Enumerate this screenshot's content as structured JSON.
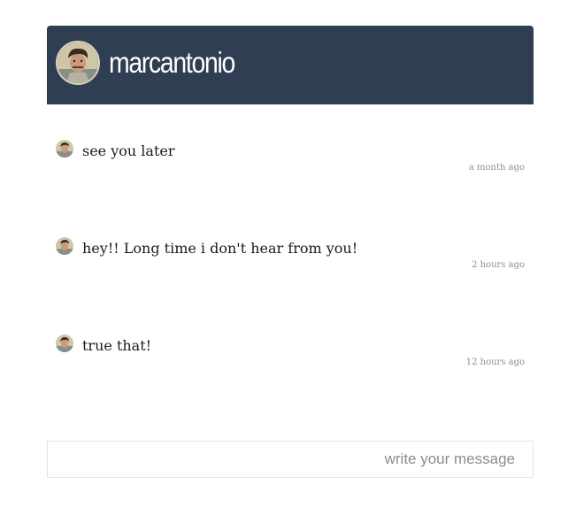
{
  "header": {
    "username": "marcantonio",
    "avatar_icon": "user-avatar-icon",
    "background_color": "#2f3e52"
  },
  "messages": [
    {
      "text": "see you later",
      "time": "a month ago"
    },
    {
      "text": "hey!! Long time i don't hear from you!",
      "time": "2 hours ago"
    },
    {
      "text": "true that!",
      "time": "12 hours ago"
    }
  ],
  "composer": {
    "placeholder": "write your message",
    "value": ""
  }
}
